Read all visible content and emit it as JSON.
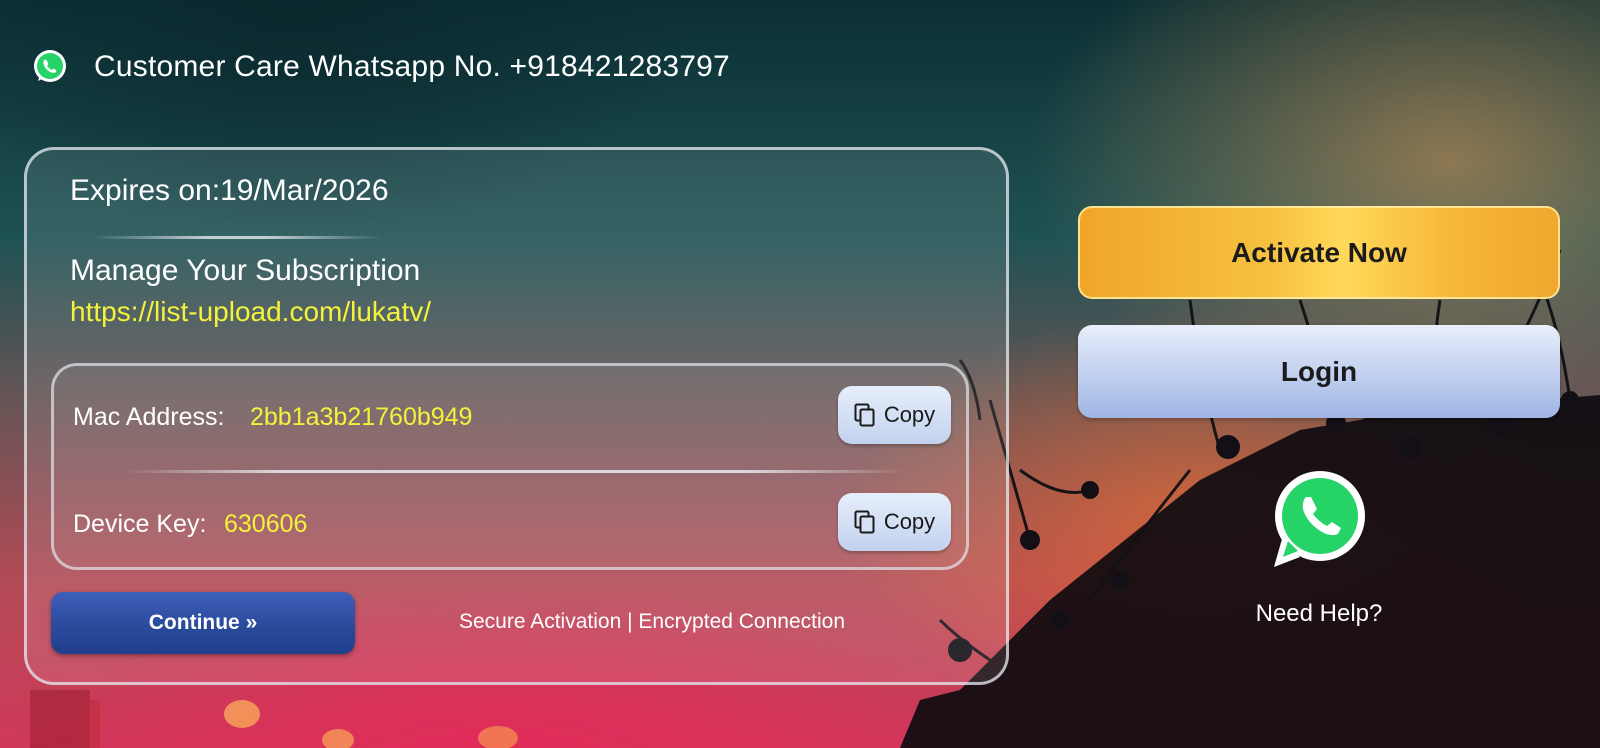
{
  "header": {
    "whatsapp_text": "Customer Care Whatsapp No. +918421283797",
    "icon": "whatsapp-icon"
  },
  "card": {
    "expires_text": "Expires on:19/Mar/2026",
    "manage_title": "Manage Your Subscription",
    "manage_url": "https://list-upload.com/lukatv/",
    "mac_label": "Mac Address:",
    "mac_value": "2bb1a3b21760b949",
    "device_key_label": "Device Key:",
    "device_key_value": "630606",
    "copy_label": "Copy",
    "continue_label": "Continue »",
    "secure_text": "Secure Activation | Encrypted Connection"
  },
  "side": {
    "activate_label": "Activate Now",
    "login_label": "Login",
    "help_label": "Need Help?",
    "help_icon": "whatsapp-icon"
  },
  "colors": {
    "highlight_text": "#f4f23a",
    "activate_gold": "#f7c140",
    "continue_blue": "#2a4a9c",
    "whatsapp_green": "#25d366"
  }
}
